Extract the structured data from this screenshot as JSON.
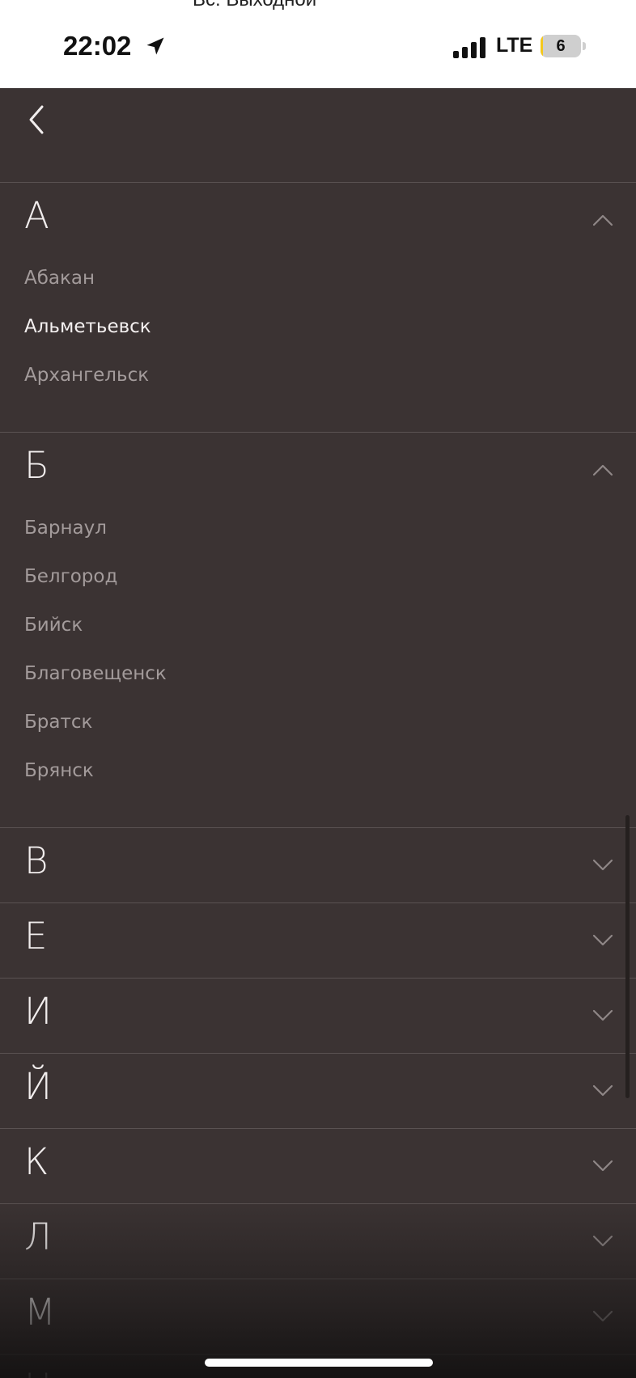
{
  "status_bar": {
    "cut_text": "Вс: Выходной",
    "time": "22:02",
    "network": "LTE",
    "battery": "6",
    "battery_level": 0.06
  },
  "nav": {
    "back_icon": "chevron-left-icon"
  },
  "sections": [
    {
      "letter": "А",
      "expanded": true,
      "cities": [
        "Абакан",
        "Альметьевск",
        "Архангельск"
      ],
      "highlighted": "Альметьевск"
    },
    {
      "letter": "Б",
      "expanded": true,
      "cities": [
        "Барнаул",
        "Белгород",
        "Бийск",
        "Благовещенск",
        "Братск",
        "Брянск"
      ]
    },
    {
      "letter": "В",
      "expanded": false
    },
    {
      "letter": "Е",
      "expanded": false
    },
    {
      "letter": "И",
      "expanded": false
    },
    {
      "letter": "Й",
      "expanded": false
    },
    {
      "letter": "К",
      "expanded": false
    },
    {
      "letter": "Л",
      "expanded": false
    },
    {
      "letter": "М",
      "expanded": false
    },
    {
      "letter": "Н",
      "expanded": false
    }
  ],
  "colors": {
    "background": "#3b3333",
    "text_active": "#f4f0f0",
    "text_muted": "#a39b9b",
    "divider": "#5a5252"
  }
}
